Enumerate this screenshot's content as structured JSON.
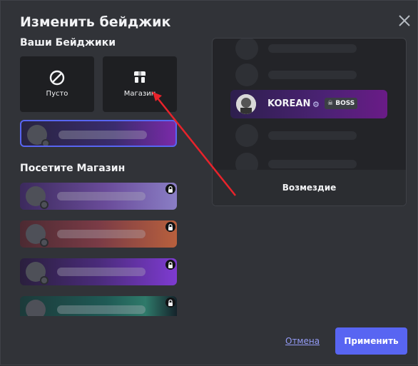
{
  "modal": {
    "title": "Изменить бейджик",
    "close_icon": "close-icon"
  },
  "your_badges": {
    "section_title": "Ваши Бейджики",
    "tiles": [
      {
        "label": "Пусто",
        "icon": "prohibited-icon"
      },
      {
        "label": "Магазин",
        "icon": "shop-icon"
      }
    ]
  },
  "shop": {
    "section_title": "Посетите Магазин"
  },
  "preview": {
    "username": "KOREAN",
    "tag": "BOSS",
    "caption": "Возмездие"
  },
  "footer": {
    "cancel_label": "Отмена",
    "apply_label": "Применить"
  },
  "colors": {
    "accent": "#5865f2",
    "link": "#949cf7",
    "arrow": "#e8232b"
  }
}
